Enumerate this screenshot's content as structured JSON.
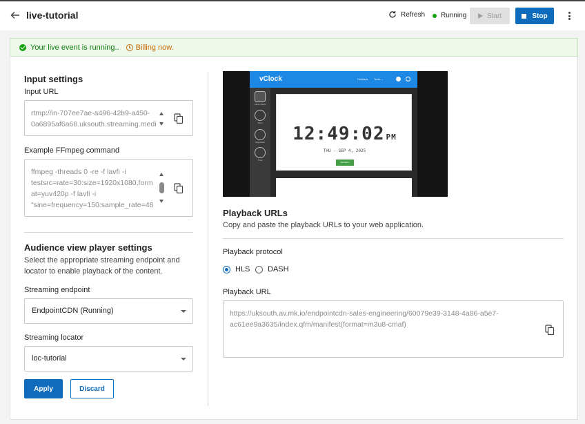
{
  "header": {
    "title": "live-tutorial",
    "refresh_label": "Refresh",
    "status_label": "Running",
    "start_label": "Start",
    "stop_label": "Stop"
  },
  "banner": {
    "running_text": "Your live event is running..",
    "billing_text": "Billing now."
  },
  "input_settings": {
    "heading": "Input settings",
    "input_url_label": "Input URL",
    "input_url_value": "rtmp://in-707ee7ae-a496-42b9-a450-\n0a6895af6a68.uksouth.streaming.medi",
    "ffmpeg_label": "Example FFmpeg command",
    "ffmpeg_value": "ffmpeg -threads 0 -re -f lavfi -i\ntestsrc=rate=30:size=1920x1080,form\nat=yuv420p -f lavfi -i\n\"sine=frequency=150:sample_rate=48"
  },
  "audience": {
    "heading": "Audience view player settings",
    "description_line1": "Select the appropriate streaming endpoint and",
    "description_line2": "locator to enable playback of the content.",
    "endpoint_label": "Streaming endpoint",
    "endpoint_value": "EndpointCDN (Running)",
    "locator_label": "Streaming locator",
    "locator_value": "loc-tutorial",
    "apply_label": "Apply",
    "discard_label": "Discard"
  },
  "preview": {
    "app_logo": "vClock",
    "nav_items": [
      "Holidays",
      "Tools ⌄"
    ],
    "side_items": [
      "Alarm Clock",
      "Timer",
      "Stopwatch",
      "Time"
    ],
    "time": "12:49:02",
    "ampm": "PM",
    "date": "THU - SEP 4, 2025",
    "set_button": "Set Alarm"
  },
  "playback": {
    "heading": "Playback URLs",
    "description": "Copy and paste the playback URLs to your web application.",
    "protocol_label": "Playback protocol",
    "options": [
      "HLS",
      "DASH"
    ],
    "selected": "HLS",
    "url_label": "Playback URL",
    "url_value": "https://uksouth.av.mk.io/endpointcdn-sales-engineering/60079e39-3148-4a86-a5e7-\nac61ee9a3635/index.qfm/manifest(format=m3u8-cmaf)"
  },
  "colors": {
    "accent": "#0f6cbd",
    "success": "#13a10e",
    "warning": "#c96a00"
  }
}
